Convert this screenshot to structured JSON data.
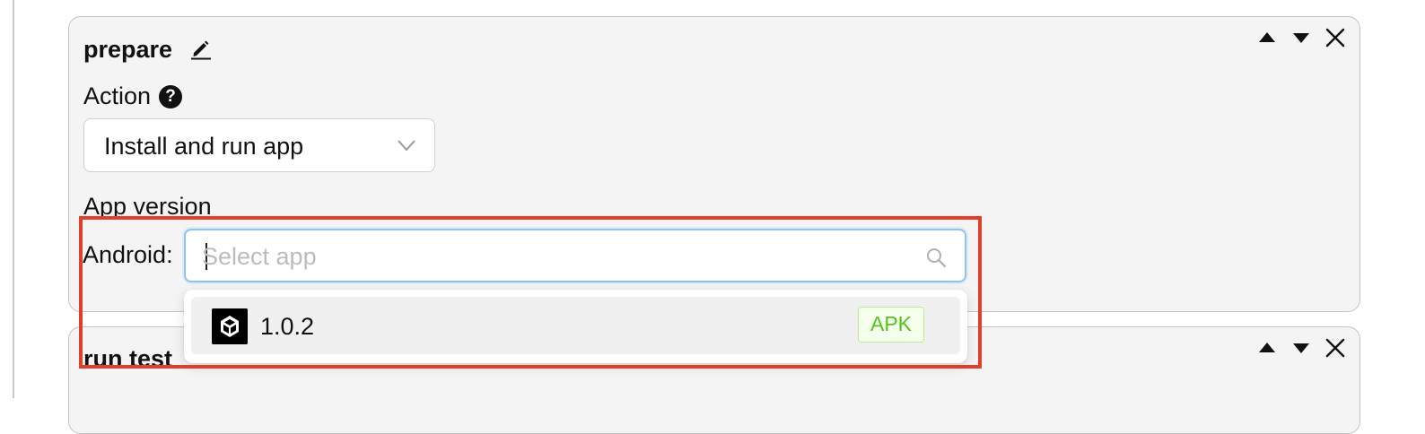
{
  "steps": [
    {
      "title": "prepare"
    },
    {
      "title": "run test"
    }
  ],
  "action": {
    "label": "Action",
    "help_glyph": "?",
    "selected": "Install and run app"
  },
  "app_version": {
    "label": "App version",
    "android_label": "Android:",
    "search": {
      "placeholder": "Select app",
      "value": ""
    }
  },
  "dropdown": {
    "options": [
      {
        "label": "1.0.2",
        "badge": "APK",
        "icon": "unity-logo-icon"
      }
    ]
  },
  "colors": {
    "card_background": "#f4f4f4",
    "card_border": "#c4c4c4",
    "focus_border": "#8cc3f2",
    "badge_text": "#52c41a",
    "badge_border": "#b7eb8f",
    "badge_background": "#f6ffed",
    "highlight": "#e0402a"
  },
  "icons": {
    "edit": "pencil-icon",
    "move_up": "caret-up-icon",
    "move_down": "caret-down-icon",
    "remove": "close-icon",
    "help": "question-circle-icon",
    "select_arrow": "chevron-down-icon",
    "search": "search-icon"
  }
}
